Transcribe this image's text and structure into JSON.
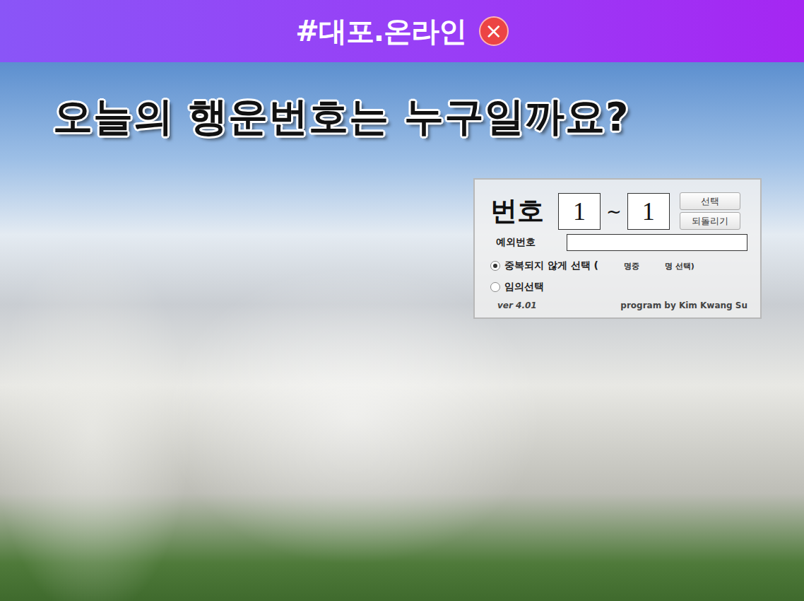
{
  "window": {
    "title": "#대포.온라인",
    "close": "×"
  },
  "headline": "오늘의 행운번호는 누구일까요?",
  "panel": {
    "label": "번호",
    "from": "1",
    "separator": "~",
    "to": "1",
    "buttons": [
      "선택",
      "되돌리기"
    ],
    "exception": {
      "label": "예외번호",
      "value": ""
    },
    "options": [
      {
        "label": "중복되지 않게 선택 (",
        "selected": true,
        "kind": "count",
        "count_fields": [
          {
            "value": "",
            "suffix": "명중"
          },
          {
            "value": "",
            "suffix": "명 선택)"
          }
        ]
      },
      {
        "label": "임의선택",
        "selected": false,
        "kind": "plain"
      }
    ],
    "version": "ver 4.01",
    "credit": "program by Kim Kwang Su"
  }
}
